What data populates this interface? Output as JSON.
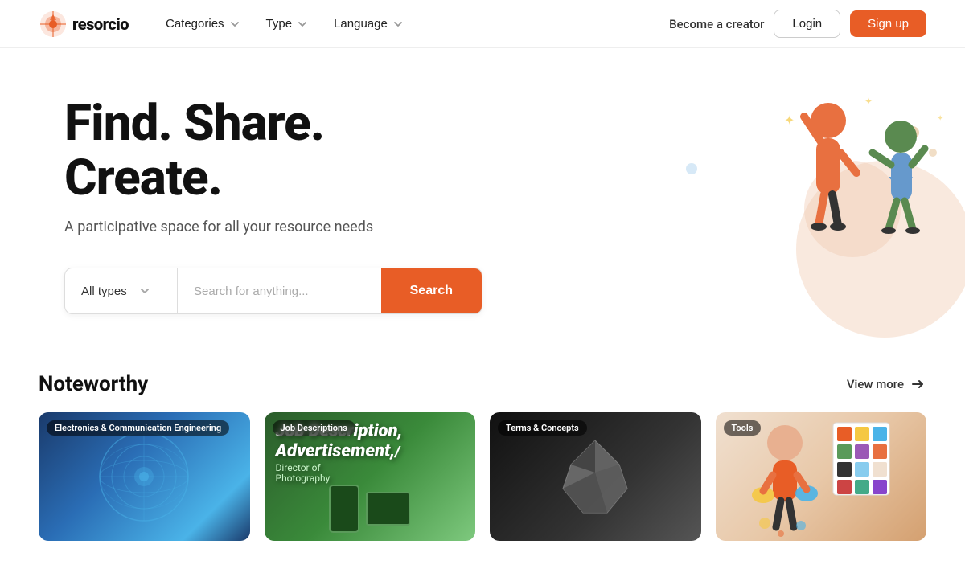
{
  "brand": {
    "name": "resorcio",
    "logo_accent": "#e85d26"
  },
  "nav": {
    "categories_label": "Categories",
    "type_label": "Type",
    "language_label": "Language",
    "become_creator_label": "Become a creator",
    "login_label": "Login",
    "signup_label": "Sign up"
  },
  "hero": {
    "title": "Find. Share. Create.",
    "subtitle": "A participative space for all your resource needs"
  },
  "search": {
    "type_label": "All types",
    "placeholder": "Search for anything...",
    "button_label": "Search"
  },
  "noteworthy": {
    "title": "Noteworthy",
    "view_more_label": "View more",
    "cards": [
      {
        "id": "card-1",
        "tag": "Electronics & Communication Engineering",
        "color_class": "card-1"
      },
      {
        "id": "card-2",
        "tag": "Job Descriptions",
        "color_class": "card-2"
      },
      {
        "id": "card-3",
        "tag": "Terms & Concepts",
        "color_class": "card-3"
      },
      {
        "id": "card-4",
        "tag": "Tools",
        "color_class": "card-4"
      }
    ]
  },
  "colors": {
    "primary": "#e85d26",
    "swatches": [
      "#e85d26",
      "#4ab3e8",
      "#f5c842",
      "#5a9a5a",
      "#9b59b6",
      "#333",
      "#f0e0d0"
    ]
  }
}
